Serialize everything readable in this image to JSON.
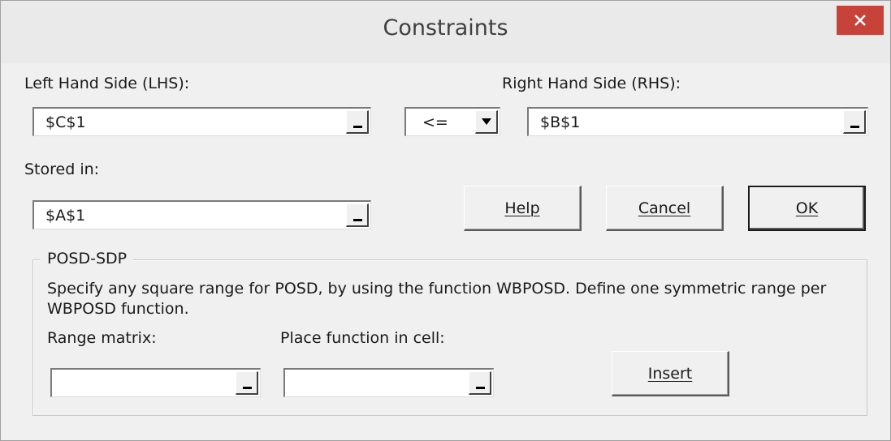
{
  "window": {
    "title": "Constraints",
    "close_glyph": "✕"
  },
  "lhs": {
    "label": "Left Hand Side (LHS):",
    "value": "$C$1"
  },
  "operator": {
    "selected": "<="
  },
  "rhs": {
    "label": "Right Hand Side (RHS):",
    "value": "$B$1"
  },
  "stored": {
    "label": "Stored in:",
    "value": "$A$1"
  },
  "buttons": {
    "help": "Help",
    "cancel": "Cancel",
    "ok": "OK",
    "insert": "Insert"
  },
  "posd": {
    "legend": "POSD-SDP",
    "description": "Specify any square range for POSD, by using the function WBPOSD. Define one symmetric range per WBPOSD function.",
    "range_label": "Range matrix:",
    "range_value": "",
    "place_label": "Place function in cell:",
    "place_value": ""
  },
  "icons": {
    "close": "close-icon",
    "ref_collapse": "collapse-dialog-icon",
    "dropdown": "chevron-down-icon"
  },
  "colors": {
    "close_button": "#c7433a",
    "dialog_bg": "#f0f0f0",
    "titlebar_bg": "#eaeaea"
  }
}
